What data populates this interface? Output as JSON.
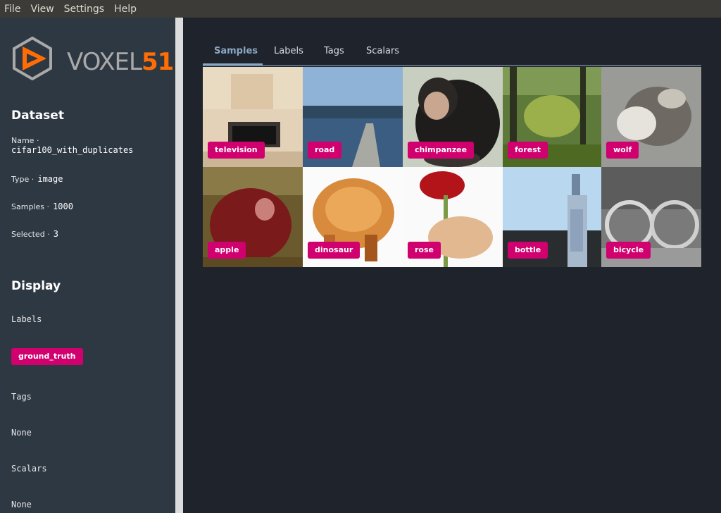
{
  "menubar": {
    "items": [
      "File",
      "View",
      "Settings",
      "Help"
    ]
  },
  "logo": {
    "voxel": "VOXEL",
    "num": "51"
  },
  "sidebar": {
    "dataset": {
      "title": "Dataset",
      "name_label": "Name ·",
      "name_value": "cifar100_with_duplicates",
      "type_label": "Type ·",
      "type_value": "image",
      "samples_label": "Samples ·",
      "samples_value": "1000",
      "selected_label": "Selected ·",
      "selected_value": "3"
    },
    "display": {
      "title": "Display",
      "labels_heading": "Labels",
      "label_chip": "ground_truth",
      "tags_heading": "Tags",
      "tags_value": "None",
      "scalars_heading": "Scalars",
      "scalars_value": "None"
    }
  },
  "tabs": [
    "Samples",
    "Labels",
    "Tags",
    "Scalars"
  ],
  "active_tab": "Samples",
  "samples": [
    {
      "label": "television",
      "selected": true
    },
    {
      "label": "road",
      "selected": false
    },
    {
      "label": "chimpanzee",
      "selected": true
    },
    {
      "label": "forest",
      "selected": false
    },
    {
      "label": "wolf",
      "selected": false
    },
    {
      "label": "apple",
      "selected": false
    },
    {
      "label": "dinosaur",
      "selected": true
    },
    {
      "label": "rose",
      "selected": false
    },
    {
      "label": "bottle",
      "selected": false
    },
    {
      "label": "bicycle",
      "selected": false
    }
  ],
  "colors": {
    "accent": "#d0006f",
    "selection": "#ff8a1f",
    "brand_orange": "#ff6d04",
    "sidebar": "#2e3843",
    "main_bg": "#1f242c"
  }
}
